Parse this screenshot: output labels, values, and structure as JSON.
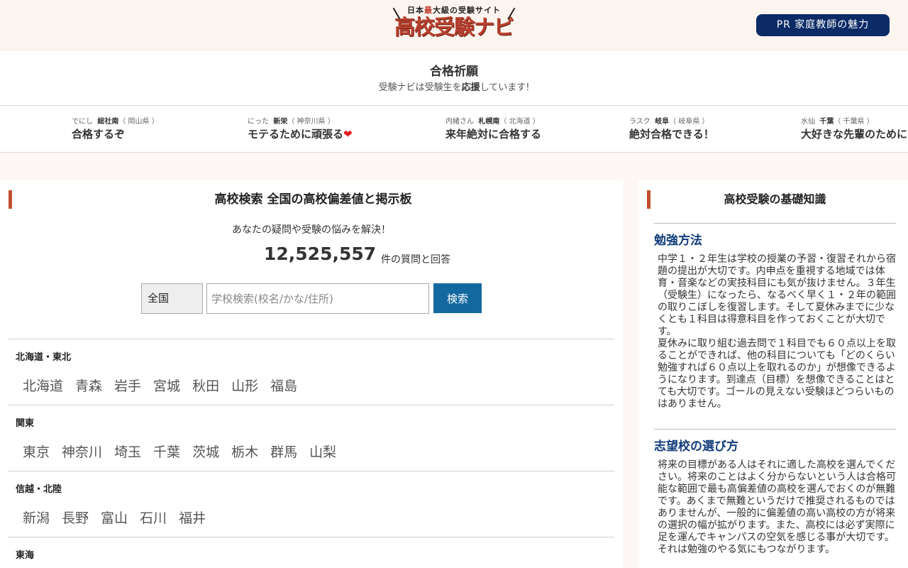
{
  "header": {
    "logo_tagline": "日本最大級の受験サイト",
    "logo_title": "高校受験ナビ",
    "pr_button": "PR 家庭教師の魅力"
  },
  "wishes": {
    "title": "合格祈願",
    "subtitle_pre": "受験ナビは受験生を",
    "subtitle_bold": "応援",
    "subtitle_post": "しています!",
    "items": [
      {
        "user": "でにし",
        "school": "総社南",
        "pref": "（ 岡山県 ）",
        "text": "合格するぞ"
      },
      {
        "user": "にった",
        "school": "新栄",
        "pref": "（ 神奈川県 ）",
        "text": "モテるために頑張る",
        "heart": "❤"
      },
      {
        "user": "内緒さん",
        "school": "札幌南",
        "pref": "（ 北海道 ）",
        "text": "来年絶対に合格する"
      },
      {
        "user": "ラスク",
        "school": "岐阜",
        "pref": "（ 岐阜県 ）",
        "text": "絶対合格できる！"
      },
      {
        "user": "水仙",
        "school": "千葉",
        "pref": "（ 千葉県 ）",
        "text": "大好きな先輩のために"
      }
    ]
  },
  "search": {
    "heading": "高校検索 全国の高校偏差値と掲示板",
    "lead": "あなたの疑問や受験の悩みを解決！",
    "count": "12,525,557",
    "count_suffix": "件の質問と回答",
    "select_value": "全国",
    "placeholder": "学校検索(校名/かな/住所)",
    "button": "検索"
  },
  "regions": [
    {
      "name": "北海道・東北",
      "prefs": [
        "北海道",
        "青森",
        "岩手",
        "宮城",
        "秋田",
        "山形",
        "福島"
      ]
    },
    {
      "name": "関東",
      "prefs": [
        "東京",
        "神奈川",
        "埼玉",
        "千葉",
        "茨城",
        "栃木",
        "群馬",
        "山梨"
      ]
    },
    {
      "name": "信越・北陸",
      "prefs": [
        "新潟",
        "長野",
        "富山",
        "石川",
        "福井"
      ]
    },
    {
      "name": "東海",
      "prefs": []
    }
  ],
  "sidebar": {
    "heading": "高校受験の基礎知識",
    "sections": [
      {
        "title": "勉強方法",
        "body": "中学１・２年生は学校の授業の予習・復習それから宿題の提出が大切です。内申点を重視する地域では体育・音楽などの実技科目にも気が抜けません。３年生（受験生）になったら、なるべく早く１・２年の範囲の取りこぼしを復習します。そして夏休みまでに少なくとも１科目は得意科目を作っておくことが大切です。\n夏休みに取り組む過去問で１科目でも６０点以上を取ることができれば、他の科目についても「どのくらい勉強すれば６０点以上を取れるのか」が想像できるようになります。到達点（目標）を想像できることはとても大切です。ゴールの見えない受験ほどつらいものはありません。"
      },
      {
        "title": "志望校の選び方",
        "body": "将来の目標がある人はそれに適した高校を選んでください。将来のことはよく分からないという人は合格可能な範囲で最も高偏差値の高校を選んでおくのが無難です。あくまで無難というだけで推奨されるものではありませんが、一般的に偏差値の高い高校の方が将来の選択の幅が拡がります。また、高校には必ず実際に足を運んでキャンパスの空気を感じる事が大切です。それは勉強のやる気にもつながります。"
      }
    ]
  }
}
